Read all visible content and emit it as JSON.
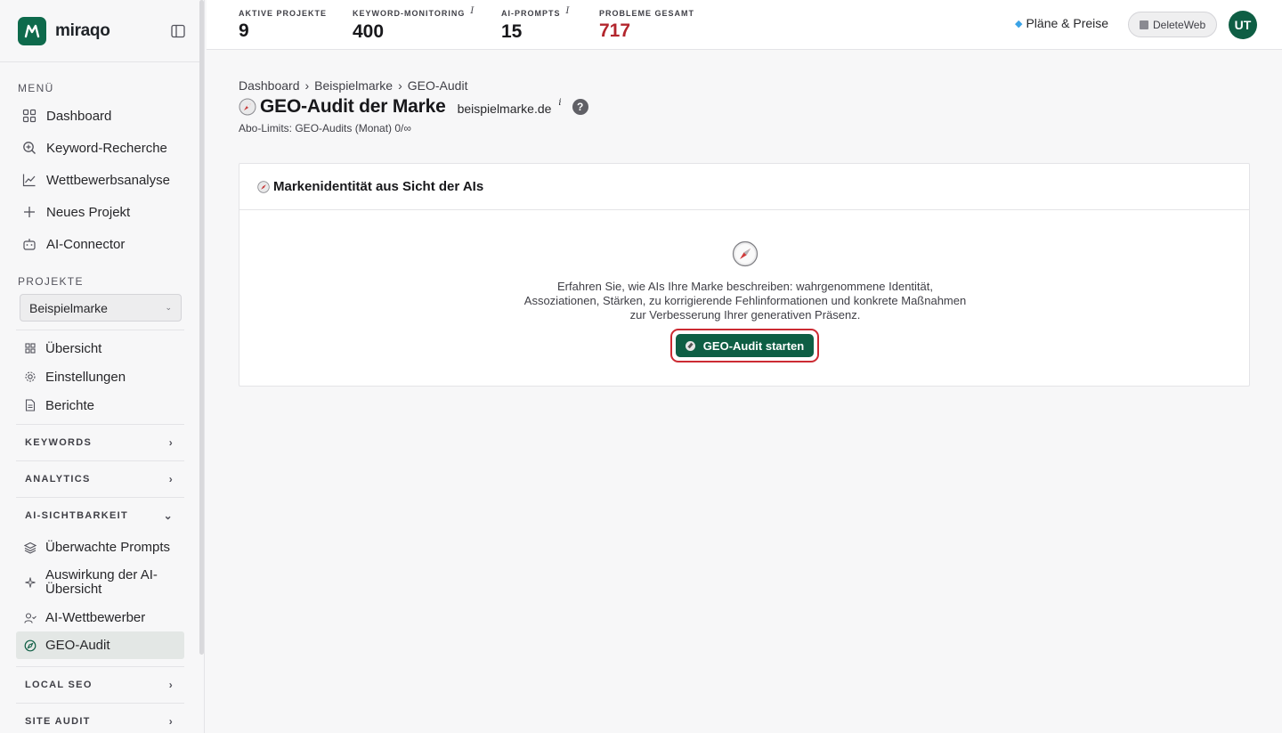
{
  "app": {
    "name": "miraqo"
  },
  "sidebar": {
    "menu_title": "MENÜ",
    "menu_items": [
      {
        "label": "Dashboard",
        "icon": "grid-icon"
      },
      {
        "label": "Keyword-Recherche",
        "icon": "search-plus-icon"
      },
      {
        "label": "Wettbewerbsanalyse",
        "icon": "line-chart-icon"
      },
      {
        "label": "Neues Projekt",
        "icon": "plus-icon"
      },
      {
        "label": "AI-Connector",
        "icon": "robot-icon"
      }
    ],
    "projects_title": "PROJEKTE",
    "project_selected": "Beispielmarke",
    "project_items": [
      {
        "label": "Übersicht",
        "icon": "grid-icon"
      },
      {
        "label": "Einstellungen",
        "icon": "gear-icon"
      },
      {
        "label": "Berichte",
        "icon": "document-icon"
      }
    ],
    "groups": {
      "keywords": "KEYWORDS",
      "analytics": "ANALYTICS",
      "ai_visibility": "AI-SICHTBARKEIT",
      "local_seo": "LOCAL SEO",
      "site_audit": "SITE AUDIT"
    },
    "ai_items": [
      {
        "label": "Überwachte Prompts",
        "icon": "layers-icon"
      },
      {
        "label": "Auswirkung der AI-Übersicht",
        "icon": "sparkle-icon"
      },
      {
        "label": "AI-Wettbewerber",
        "icon": "user-check-icon"
      },
      {
        "label": "GEO-Audit",
        "icon": "compass-icon",
        "active": true
      }
    ]
  },
  "topbar": {
    "stats": [
      {
        "label": "AKTIVE PROJEKTE",
        "value": "9",
        "info": false
      },
      {
        "label": "KEYWORD-MONITORING",
        "value": "400",
        "info": true
      },
      {
        "label": "AI-PROMPTS",
        "value": "15",
        "info": true
      },
      {
        "label": "PROBLEME GESAMT",
        "value": "717",
        "info": false,
        "color": "#b3262d"
      }
    ],
    "plans_label": "Pläne & Preise",
    "workspace_label": "DeleteWeb",
    "avatar_initials": "UT",
    "info_glyph": "i"
  },
  "page": {
    "breadcrumbs": [
      "Dashboard",
      "Beispielmarke",
      "GEO-Audit"
    ],
    "crumb_separator": "›",
    "title": "GEO-Audit der Marke",
    "domain": "beispielmarke.de",
    "info_glyph": "i",
    "help_glyph": "?",
    "limits": "Abo-Limits: GEO-Audits (Monat) 0/∞"
  },
  "card": {
    "title": "Markenidentität aus Sicht der AIs",
    "description": "Erfahren Sie, wie AIs Ihre Marke beschreiben: wahrgenommene Identität, Assoziationen, Stärken, zu korrigierende Fehlinformationen und konkrete Maßnahmen zur Verbesserung Ihrer generativen Präsenz.",
    "cta_label": "GEO-Audit starten"
  },
  "colors": {
    "brand": "#0e6a4c",
    "button": "#0e5e44",
    "highlight_ring": "#cc2b33",
    "problems_value": "#b3262d"
  }
}
